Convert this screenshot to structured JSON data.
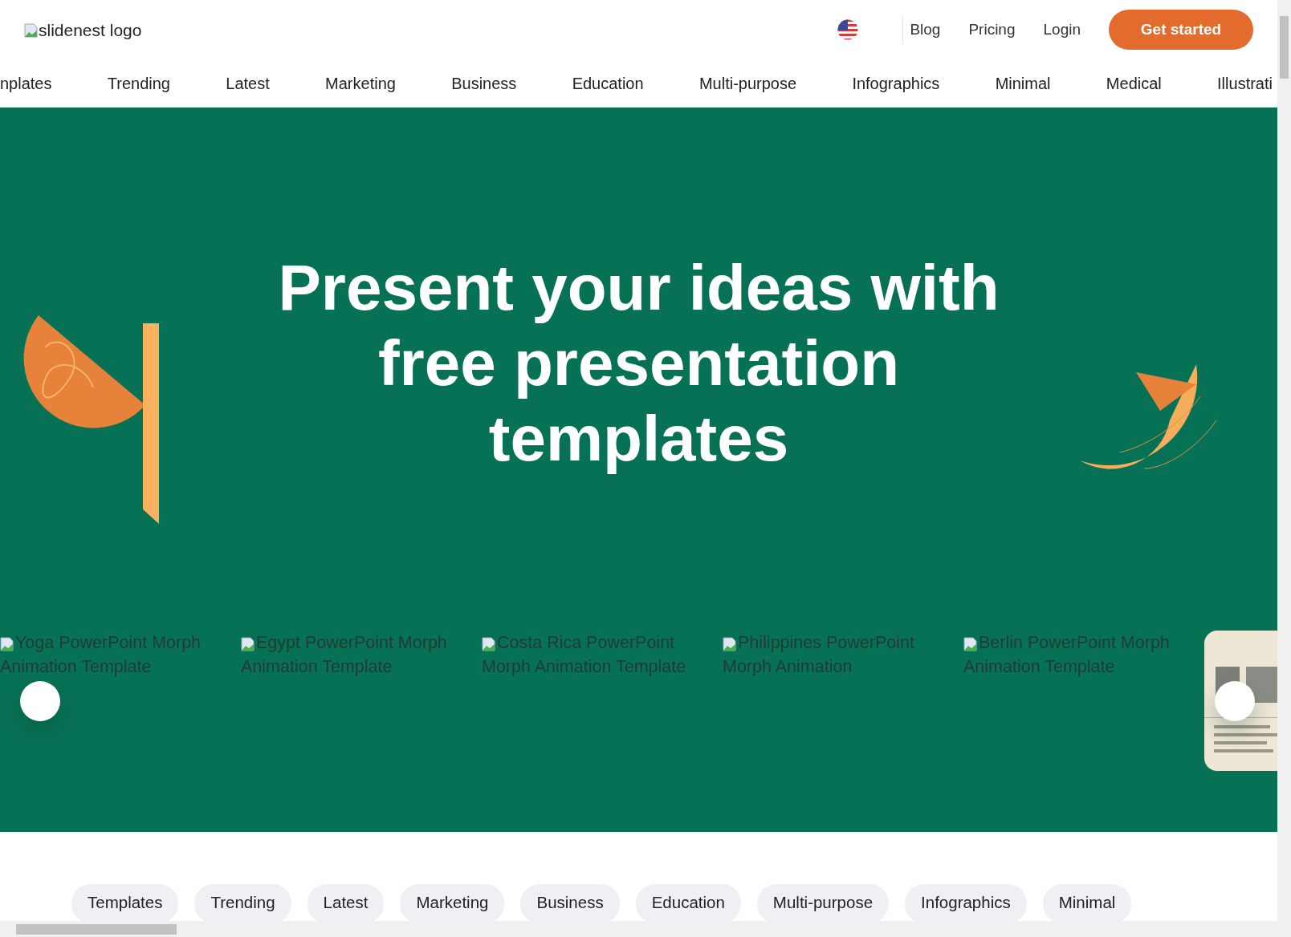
{
  "header": {
    "logo_alt": "slidenest logo",
    "links": [
      "Blog",
      "Pricing",
      "Login"
    ],
    "cta": "Get started"
  },
  "category_nav": [
    "nplates",
    "Trending",
    "Latest",
    "Marketing",
    "Business",
    "Education",
    "Multi-purpose",
    "Infographics",
    "Minimal",
    "Medical",
    "Illustrati"
  ],
  "hero": {
    "title": "Present your ideas with free presentation templates",
    "templates": [
      {
        "kind": "broken-image",
        "alt": "Yoga PowerPoint Morph Animation Template"
      },
      {
        "kind": "broken-image",
        "alt": "Egypt PowerPoint Morph Animation Template"
      },
      {
        "kind": "broken-image",
        "alt": "Costa Rica PowerPoint Morph Animation Template"
      },
      {
        "kind": "broken-image",
        "alt": "Philippines PowerPoint Morph Animation"
      },
      {
        "kind": "broken-image",
        "alt": "Berlin PowerPoint Morph Animation Template"
      },
      {
        "kind": "picture"
      }
    ]
  },
  "category_chips": [
    "Templates",
    "Trending",
    "Latest",
    "Marketing",
    "Business",
    "Education",
    "Multi-purpose",
    "Infographics",
    "Minimal"
  ]
}
